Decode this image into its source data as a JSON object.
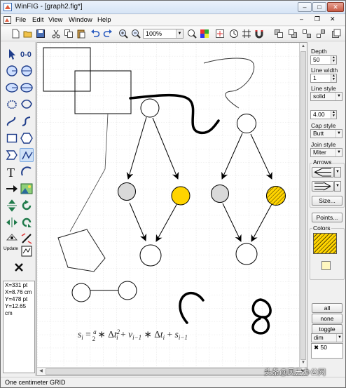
{
  "window": {
    "title": "WinFIG - [graph2.fig*]"
  },
  "menu": [
    {
      "label": "File",
      "underline_char": "F"
    },
    {
      "label": "Edit",
      "underline_char": "E"
    },
    {
      "label": "View",
      "underline_char": "V"
    },
    {
      "label": "Window",
      "underline_char": "W"
    },
    {
      "label": "Help",
      "underline_char": "H"
    }
  ],
  "toolbar": {
    "zoom": "100%"
  },
  "coords": {
    "x_pt": "X=331 pt",
    "x_cm": "X=8.76 cm",
    "y_pt": "Y=478 pt",
    "y_cm": "Y=12.65 cm"
  },
  "tools": [
    "select-pointer",
    "point-tool",
    "circle-radius",
    "circle-diameter",
    "ellipse-radius",
    "ellipse-diameter",
    "closed-spline-approx",
    "closed-spline-interp",
    "open-spline-approx",
    "open-spline-interp",
    "box-tool",
    "polygon-tool",
    "rounded-box",
    "spline-curve",
    "text-tool",
    "arc-tool",
    "move-tool",
    "picture-tool",
    "align-tool",
    "rotate-tool",
    "flip-tool",
    "scale-tool",
    "update-tool",
    "library-tool",
    "delete-tool"
  ],
  "update_label": "Update",
  "canvas": {
    "formula_text": "s_i = (a/2) * Δt_i^2 + v_(i-1) * Δt_i + s_(i-1)",
    "colors": {
      "node_fill": "#ffffff",
      "node_gray": "#d9d9d9",
      "node_yellow": "#ffd400"
    }
  },
  "rightpanel": {
    "depth_label": "Depth",
    "depth_value": "50",
    "linewidth_label": "Line width",
    "linewidth_value": "1",
    "linestyle_label": "Line style",
    "linestyle_value": "solid",
    "dashlen_value": "4.00",
    "capstyle_label": "Cap style",
    "capstyle_value": "Butt",
    "joinstyle_label": "Join style",
    "joinstyle_value": "Miter",
    "arrows_label": "Arrows",
    "size_button": "Size...",
    "points_button": "Points...",
    "colors_label": "Colors",
    "all_button": "all",
    "none_button": "none",
    "toggle_button": "toggle",
    "dim_value": "dim",
    "list_value": "50"
  },
  "statusbar": {
    "text": "One centimeter GRID"
  },
  "watermark": "头条@风云办公网"
}
